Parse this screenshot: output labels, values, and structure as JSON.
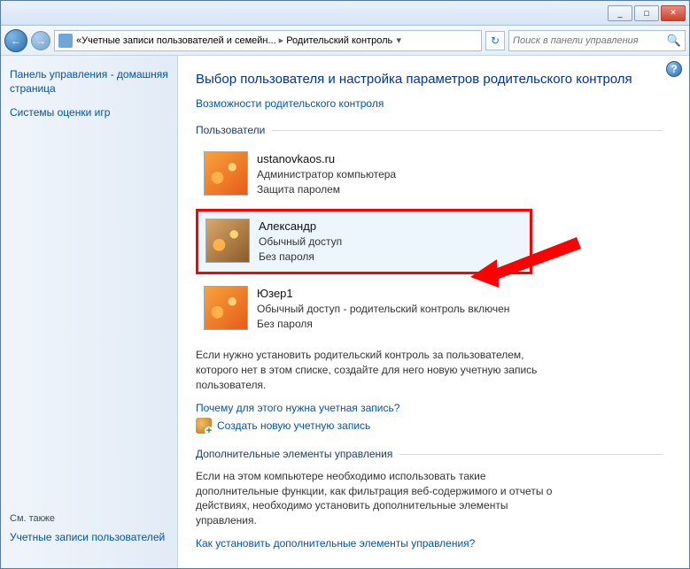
{
  "titlebar": {
    "min_label": "_",
    "max_label": "□",
    "close_label": "✕"
  },
  "navbar": {
    "back_glyph": "←",
    "fwd_glyph": "→",
    "breadcrumb_prefix": "«",
    "breadcrumb_item1": "Учетные записи пользователей и семейн...",
    "breadcrumb_item2": "Родительский контроль",
    "breadcrumb_drop": "▾",
    "refresh_glyph": "↻",
    "search_placeholder": "Поиск в панели управления",
    "search_glyph": "🔍"
  },
  "sidebar": {
    "home_link": "Панель управления - домашняя страница",
    "rating_link": "Системы оценки игр",
    "see_also_heading": "См. также",
    "accounts_link": "Учетные записи пользователей"
  },
  "main": {
    "heading": "Выбор пользователя и настройка параметров родительского контроля",
    "capabilities_link": "Возможности родительского контроля",
    "users_section": "Пользователи",
    "users": [
      {
        "name": "ustanovkaos.ru",
        "role": "Администратор компьютера",
        "status": "Защита паролем",
        "avatar": "flower"
      },
      {
        "name": "Александр",
        "role": "Обычный доступ",
        "status": "Без пароля",
        "avatar": "guitar",
        "highlighted": true
      },
      {
        "name": "Юзер1",
        "role": "Обычный доступ - родительский контроль включен",
        "status": "Без пароля",
        "avatar": "flower"
      }
    ],
    "note_text": "Если нужно установить родительский контроль за пользователем, которого нет в этом списке, создайте для него новую учетную запись пользователя.",
    "why_account_link": "Почему для этого нужна учетная запись?",
    "create_account_link": "Создать новую учетную запись",
    "extra_section": "Дополнительные элементы управления",
    "extra_text": "Если на этом компьютере необходимо использовать такие дополнительные функции, как фильтрация веб-содержимого и отчеты о действиях, необходимо установить дополнительные элементы управления.",
    "extra_link": "Как установить дополнительные элементы управления?",
    "help_glyph": "?"
  },
  "colors": {
    "highlight": "#ff0000",
    "link": "#0354a3",
    "heading": "#003399"
  }
}
